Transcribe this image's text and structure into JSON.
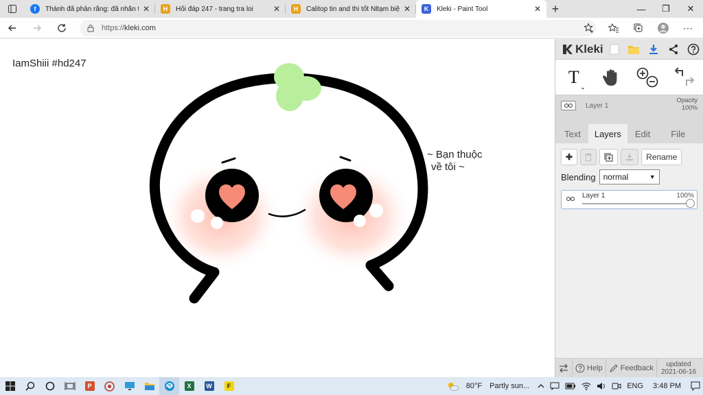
{
  "browser": {
    "tabs": [
      {
        "title": "Thành đã phản rằng: đã nhắn tin",
        "favicon": "facebook-icon",
        "color": "#1877f2"
      },
      {
        "title": "Hỏi đáp 247 - trang tra loi",
        "favicon": "hoidap247-icon",
        "color": "#e8a21b"
      },
      {
        "title": "Calitop tin and thi tốt Nltạm biệt",
        "favicon": "hoidap247-icon",
        "color": "#e8a21b"
      },
      {
        "title": "Kleki - Paint Tool",
        "favicon": "kleki-icon",
        "color": "#3b62d9"
      }
    ],
    "url_protocol": "https://",
    "url_host": "kleki.com"
  },
  "canvas": {
    "watermark": "IamShiii #hd247",
    "caption_line1": "~ Bạn thuộc",
    "caption_line2": "về tôi ~"
  },
  "panel": {
    "brand": "Kleki",
    "layer_name": "Layer 1",
    "opacity_label": "Opacity",
    "opacity_value": "100%",
    "tabs": [
      "Text",
      "Layers",
      "Edit",
      "File"
    ],
    "active_tab": "Layers",
    "rename_label": "Rename",
    "blending_label": "Blending",
    "blending_value": "normal",
    "layer_item": {
      "name": "Layer 1",
      "opacity": "100%"
    },
    "footer": {
      "help": "Help",
      "feedback": "Feedback",
      "updated_label": "updated",
      "updated_date": "2021-06-16"
    }
  },
  "taskbar": {
    "weather_temp": "80°F",
    "weather_desc": "Partly sun...",
    "lang": "ENG",
    "time": "3:48 PM"
  },
  "colors": {
    "accent": "#3b62d9",
    "sprout": "#b9ef9c",
    "heart": "#f58a76",
    "blush": "#ffd2c9"
  }
}
